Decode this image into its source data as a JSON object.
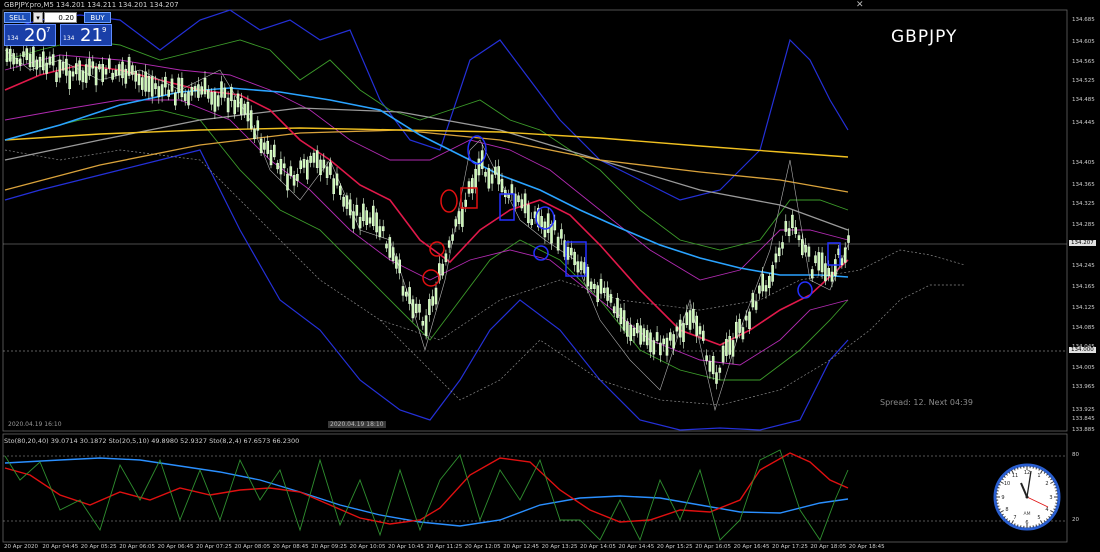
{
  "chart": {
    "title": "GBPJPY.pro,M5  134.201 134.211 134.201 134.207",
    "symbol": "GBPJPY",
    "spread_text": "Spread: 12. Next 04:39",
    "date_marker_left": "2020.04.19 16:10",
    "date_marker_mid": "2020.04.19 18:10",
    "current_price": "134.207",
    "level_price": "134.000"
  },
  "trade_panel": {
    "sell_label": "SELL",
    "buy_label": "BUY",
    "lot": "0.20",
    "dropdown_glyph": "▾",
    "sell_prefix": "134",
    "sell_big": "20",
    "sell_sup": "7",
    "buy_prefix": "134",
    "buy_big": "21",
    "buy_sup": "9"
  },
  "price_axis": [
    "134.685",
    "134.605",
    "134.565",
    "134.525",
    "134.485",
    "134.445",
    "134.405",
    "134.365",
    "134.325",
    "134.285",
    "134.245",
    "134.165",
    "134.125",
    "134.085",
    "134.045",
    "134.005",
    "133.965",
    "133.925",
    "133.885",
    "133.845"
  ],
  "time_axis": [
    "20 Apr 2020",
    "20 Apr 04:45",
    "20 Apr 05:25",
    "20 Apr 06:05",
    "20 Apr 06:45",
    "20 Apr 07:25",
    "20 Apr 08:05",
    "20 Apr 08:45",
    "20 Apr 09:25",
    "20 Apr 10:05",
    "20 Apr 10:45",
    "20 Apr 11:25",
    "20 Apr 12:05",
    "20 Apr 12:45",
    "20 Apr 13:25",
    "20 Apr 14:05",
    "20 Apr 14:45",
    "20 Apr 15:25",
    "20 Apr 16:05",
    "20 Apr 16:45",
    "20 Apr 17:25",
    "20 Apr 18:05",
    "20 Apr 18:45"
  ],
  "stoch": {
    "label": "Sto(80,20,40) 39.0714 30.1872  Sto(20,5,10) 49.8980 52.9327  Sto(8,2,4) 67.6573 66.2300",
    "levels": [
      "80",
      "20"
    ]
  },
  "clock": {
    "ampm": "AM"
  },
  "colors": {
    "background": "#000000",
    "candle": "#c8f5b0",
    "ma_red": "#e0194a",
    "ma_blue": "#2aa3ff",
    "ma_orange": "#d9a23b",
    "ma_yellow": "#f0c020",
    "ma_gray": "#9a9a9a",
    "band_green": "#3c9b2a",
    "band_purple": "#b02ab0",
    "band_blue": "#2430d8",
    "sell_button": "#1c4fb8"
  }
}
